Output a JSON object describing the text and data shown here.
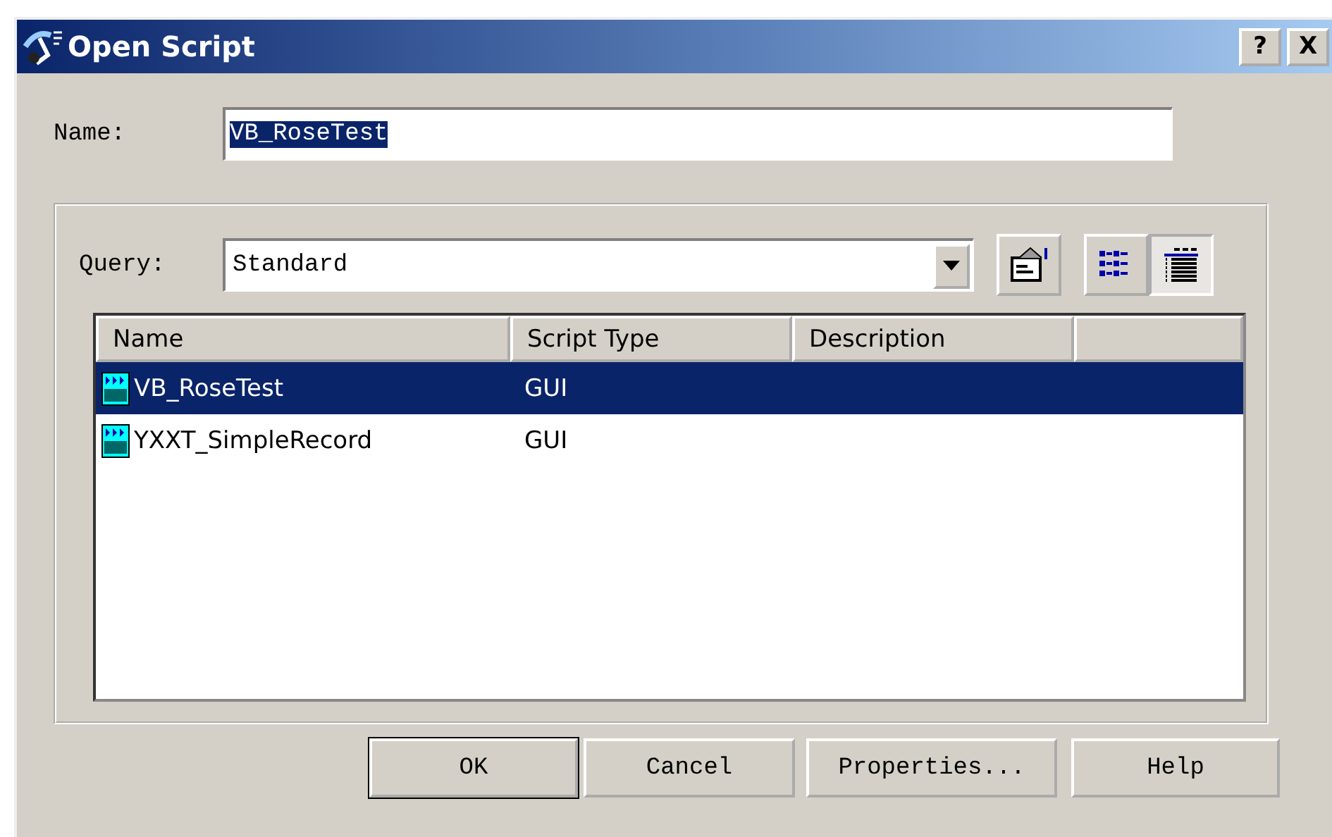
{
  "window": {
    "title": "Open Script",
    "buttons": [
      "?",
      "X"
    ]
  },
  "name_field": {
    "label": "Name:",
    "value": "VB_RoseTest"
  },
  "query": {
    "label": "Query:",
    "value": "Standard"
  },
  "view_modes": [
    {
      "kind": "list",
      "selected": false
    },
    {
      "kind": "details",
      "selected": true
    }
  ],
  "table": {
    "columns": [
      "Name",
      "Script Type",
      "Description"
    ],
    "rows": [
      {
        "name": "VB_RoseTest",
        "type": "GUI",
        "selected": true
      },
      {
        "name": "YXXT_SimpleRecord",
        "type": "GUI",
        "selected": false
      }
    ]
  },
  "buttons": [
    {
      "label": "OK",
      "default": true
    },
    {
      "label": "Cancel",
      "default": false
    },
    {
      "label": "Properties...",
      "default": false
    },
    {
      "label": "Help",
      "default": false
    }
  ]
}
